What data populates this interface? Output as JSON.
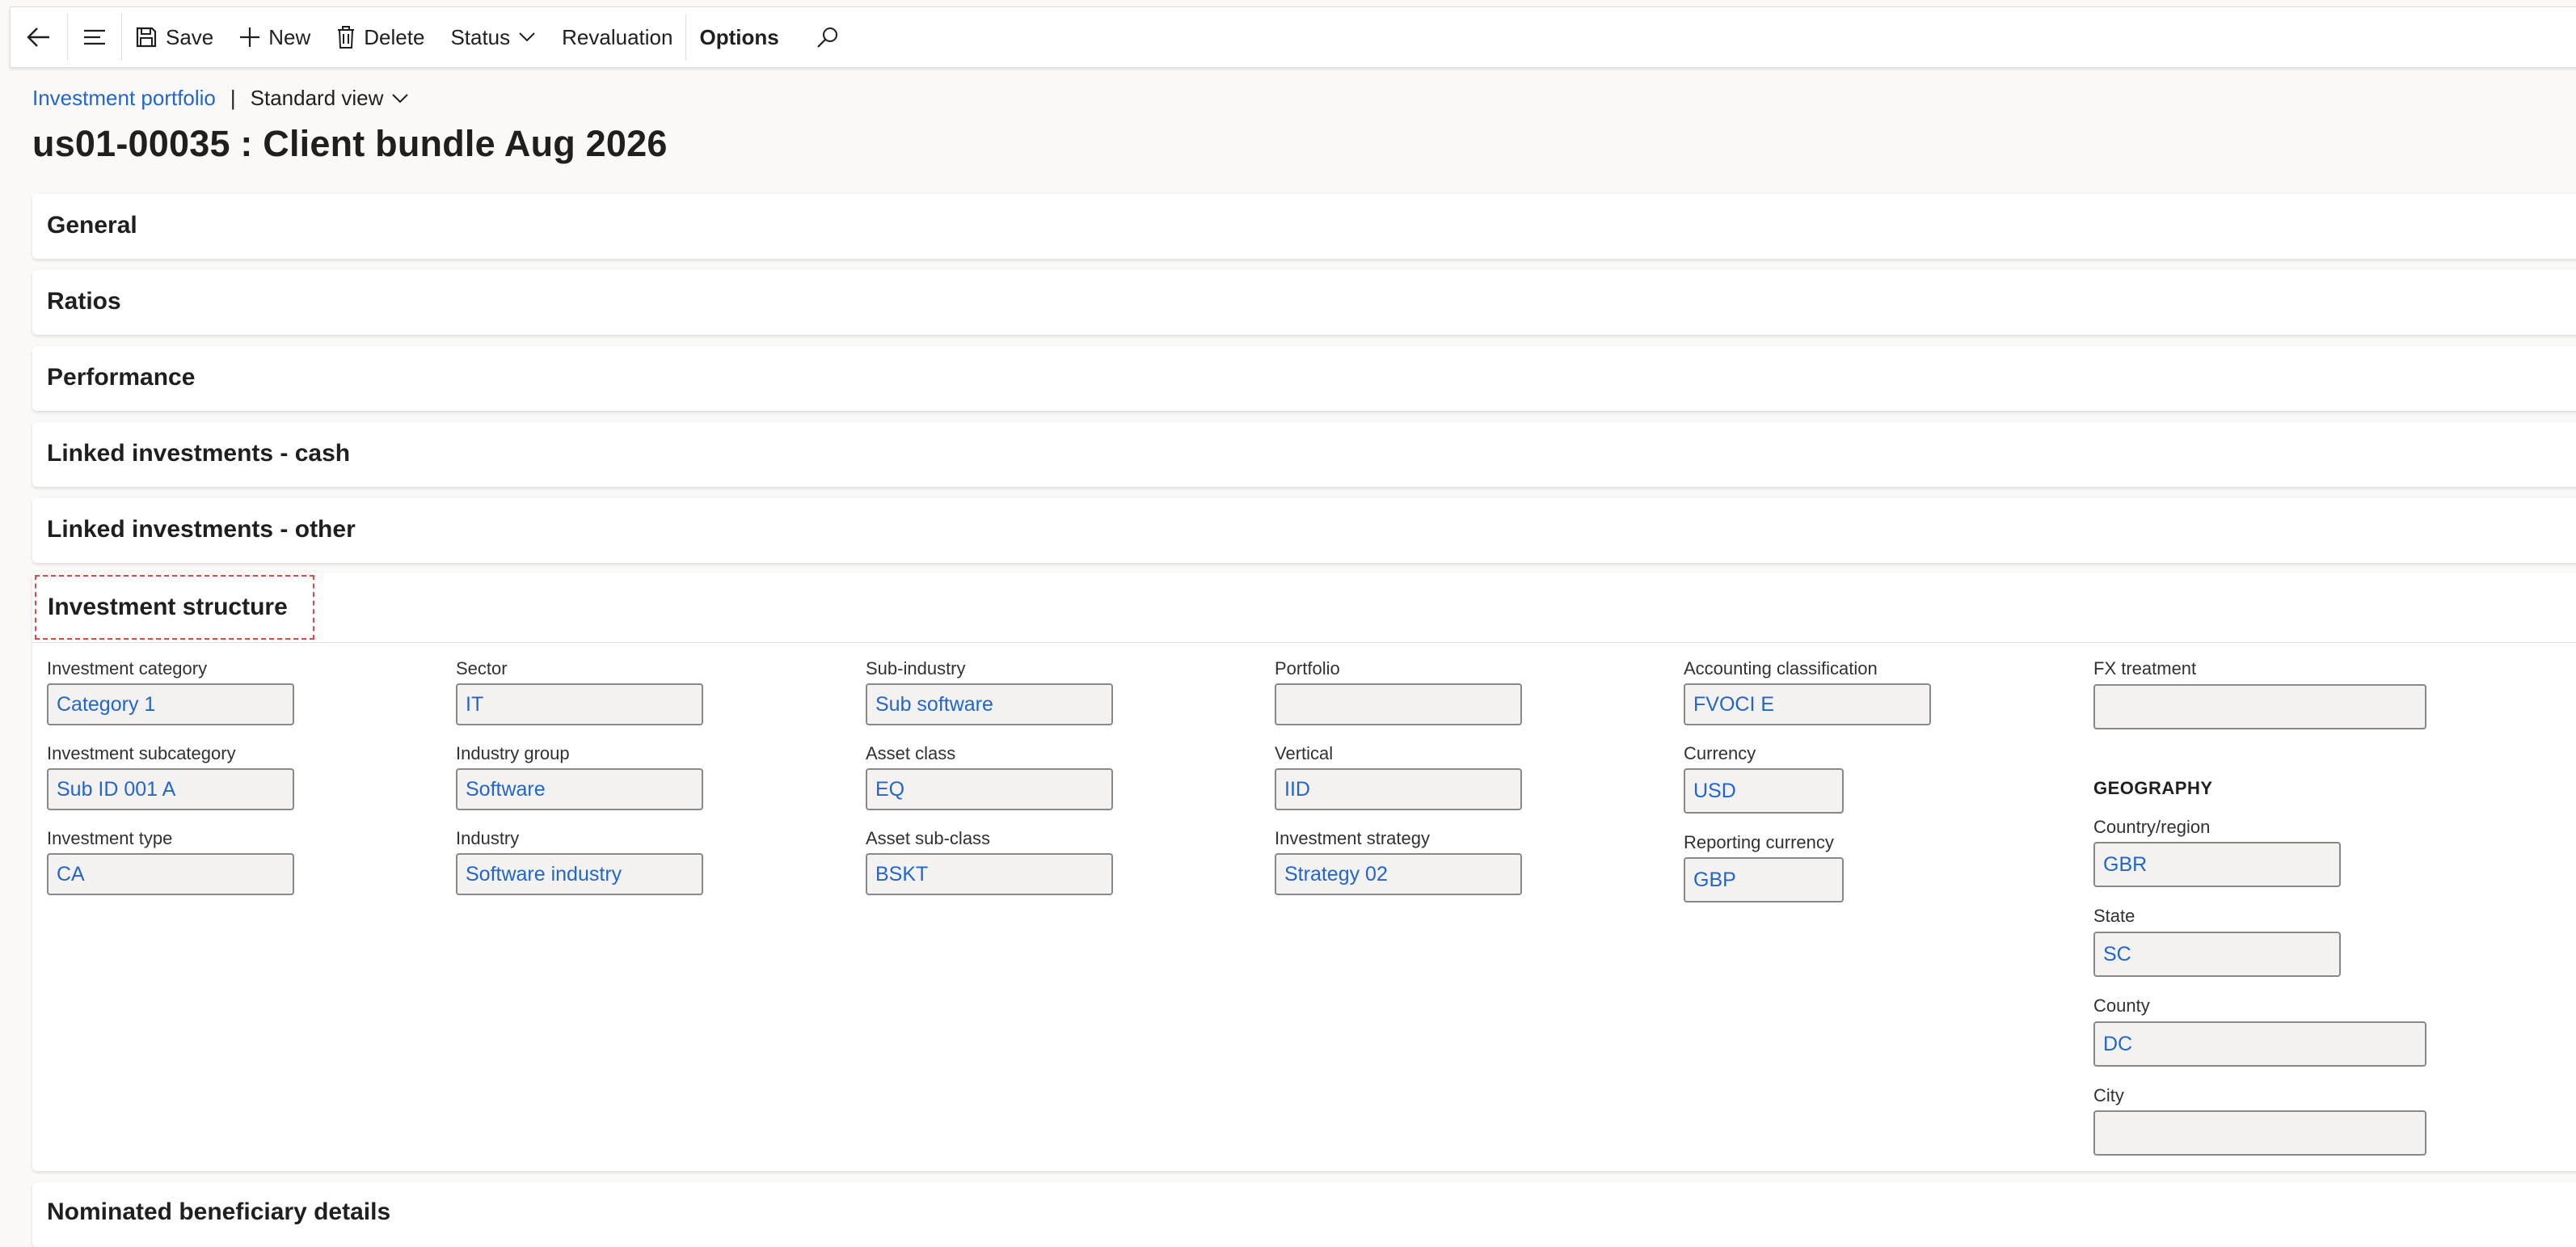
{
  "toolbar": {
    "save": "Save",
    "new": "New",
    "delete": "Delete",
    "status": "Status",
    "revaluation": "Revaluation",
    "options": "Options"
  },
  "breadcrumb": {
    "link": "Investment portfolio",
    "separator": "|",
    "view": "Standard view"
  },
  "page_title": "us01-00035 : Client bundle Aug 2026",
  "sections": {
    "general": "General",
    "ratios": "Ratios",
    "performance": "Performance",
    "linked_cash": "Linked investments - cash",
    "linked_other": "Linked investments - other",
    "investment_structure": "Investment structure",
    "nominated": "Nominated beneficiary details"
  },
  "fields": {
    "investment_category": {
      "label": "Investment category",
      "value": "Category 1"
    },
    "investment_subcategory": {
      "label": "Investment subcategory",
      "value": "Sub ID 001 A"
    },
    "investment_type": {
      "label": "Investment type",
      "value": "CA"
    },
    "sector": {
      "label": "Sector",
      "value": "IT"
    },
    "industry_group": {
      "label": "Industry group",
      "value": "Software"
    },
    "industry": {
      "label": "Industry",
      "value": "Software industry"
    },
    "sub_industry": {
      "label": "Sub-industry",
      "value": "Sub software"
    },
    "asset_class": {
      "label": "Asset class",
      "value": "EQ"
    },
    "asset_sub_class": {
      "label": "Asset sub-class",
      "value": "BSKT"
    },
    "portfolio": {
      "label": "Portfolio",
      "value": ""
    },
    "vertical": {
      "label": "Vertical",
      "value": "IID"
    },
    "investment_strategy": {
      "label": "Investment strategy",
      "value": "Strategy 02"
    },
    "accounting_classification": {
      "label": "Accounting classification",
      "value": "FVOCI E"
    },
    "currency": {
      "label": "Currency",
      "value": "USD"
    },
    "reporting_currency": {
      "label": "Reporting currency",
      "value": "GBP"
    },
    "fx_treatment": {
      "label": "FX treatment",
      "value": ""
    },
    "geography_heading": "GEOGRAPHY",
    "country_region": {
      "label": "Country/region",
      "value": "GBR"
    },
    "state": {
      "label": "State",
      "value": "SC"
    },
    "county": {
      "label": "County",
      "value": "DC"
    },
    "city": {
      "label": "City",
      "value": ""
    }
  }
}
